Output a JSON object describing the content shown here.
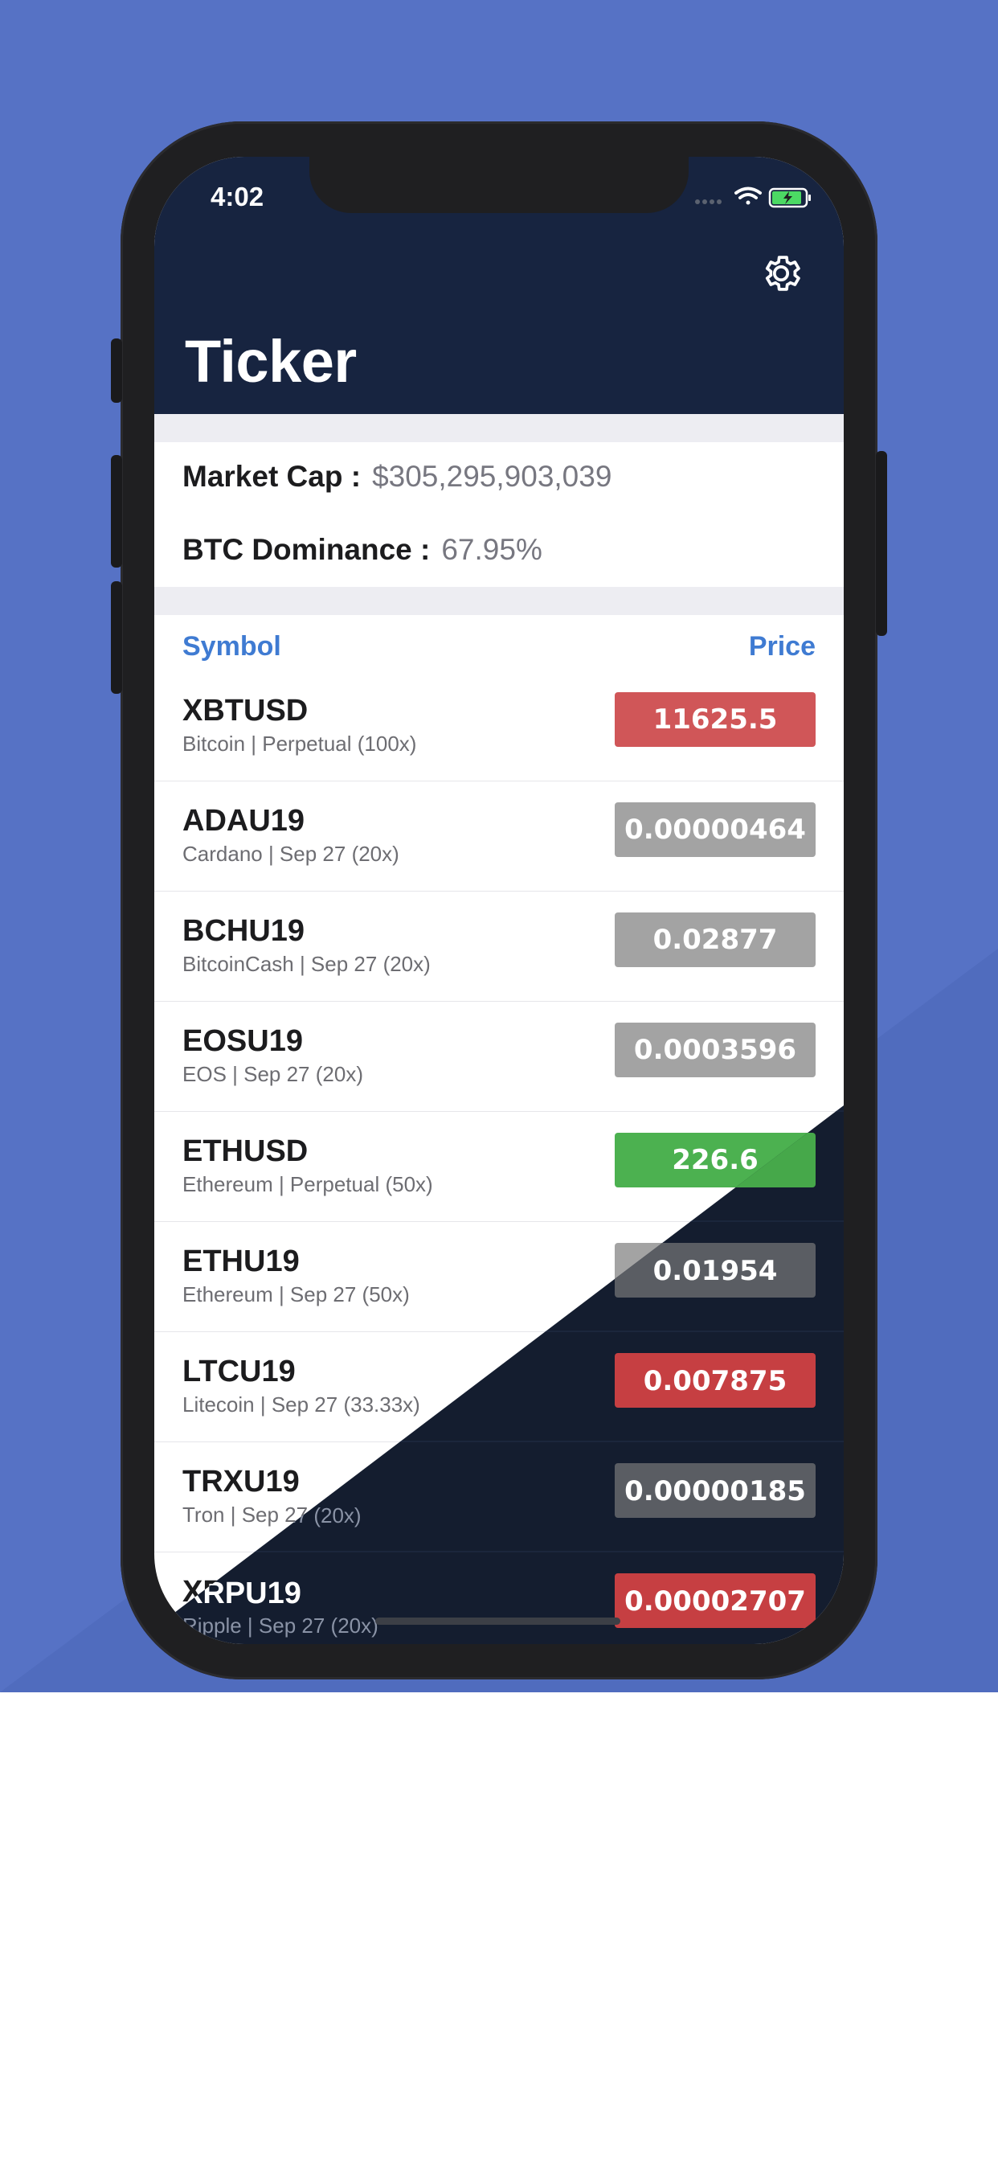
{
  "status_bar": {
    "time": "4:02"
  },
  "header": {
    "title": "Ticker",
    "settings_icon": "gear-icon"
  },
  "market": {
    "cap_label": "Market Cap :",
    "cap_value": "$305,295,903,039",
    "dominance_label": "BTC Dominance :",
    "dominance_value": "67.95%"
  },
  "columns": {
    "symbol": "Symbol",
    "price": "Price"
  },
  "colors": {
    "header_bg": "#172440",
    "accent_blue": "#3f7bd2",
    "price_red": "#d05658",
    "price_green": "#4cb150",
    "price_gray": "#a3a3a3",
    "backdrop": "#5672c5"
  },
  "tickers": [
    {
      "symbol": "XBTUSD",
      "subtitle": "Bitcoin | Perpetual (100x)",
      "price": "11625.5",
      "trend": "down"
    },
    {
      "symbol": "ADAU19",
      "subtitle": "Cardano | Sep 27 (20x)",
      "price": "0.00000464",
      "trend": "flat"
    },
    {
      "symbol": "BCHU19",
      "subtitle": "BitcoinCash | Sep 27 (20x)",
      "price": "0.02877",
      "trend": "flat"
    },
    {
      "symbol": "EOSU19",
      "subtitle": "EOS | Sep 27 (20x)",
      "price": "0.0003596",
      "trend": "flat"
    },
    {
      "symbol": "ETHUSD",
      "subtitle": "Ethereum | Perpetual (50x)",
      "price": "226.6",
      "trend": "up"
    },
    {
      "symbol": "ETHU19",
      "subtitle": "Ethereum | Sep 27 (50x)",
      "price": "0.01954",
      "trend": "flat"
    },
    {
      "symbol": "LTCU19",
      "subtitle": "Litecoin | Sep 27 (33.33x)",
      "price": "0.007875",
      "trend": "down"
    },
    {
      "symbol": "TRXU19",
      "subtitle": "Tron | Sep 27 (20x)",
      "price": "0.00000185",
      "trend": "flat"
    },
    {
      "symbol": "XRPU19",
      "subtitle": "Ripple | Sep 27 (20x)",
      "price": "0.00002707",
      "trend": "down"
    }
  ]
}
